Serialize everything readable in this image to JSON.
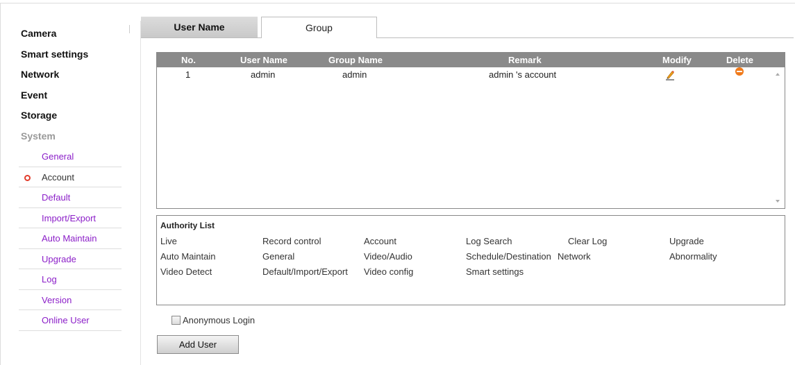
{
  "sidebar": {
    "top_items": [
      "Camera",
      "Smart settings",
      "Network",
      "Event",
      "Storage"
    ],
    "section": "System",
    "sub_items": [
      "General",
      "Account",
      "Default",
      "Import/Export",
      "Auto Maintain",
      "Upgrade",
      "Log",
      "Version",
      "Online User"
    ],
    "active_sub": "Account"
  },
  "tabs": {
    "user_name": "User Name",
    "group": "Group",
    "active": "User Name"
  },
  "user_table": {
    "headers": {
      "no": "No.",
      "user_name": "User Name",
      "group_name": "Group Name",
      "remark": "Remark",
      "modify": "Modify",
      "delete": "Delete"
    },
    "rows": [
      {
        "no": "1",
        "user_name": "admin",
        "group_name": "admin",
        "remark": "admin 's account",
        "modify_icon": "edit-pencil-icon",
        "delete_icon": "delete-circle-icon"
      }
    ]
  },
  "authority": {
    "title": "Authority List",
    "items": [
      "Live",
      "Record control",
      "Account",
      "Log Search",
      "Clear Log",
      "Upgrade",
      "Auto Maintain",
      "General",
      "Video/Audio",
      "Schedule/Destination",
      "Network",
      "Abnormality",
      "Video Detect",
      "Default/Import/Export",
      "Video config",
      "Smart settings"
    ]
  },
  "anonymous_login": {
    "label": "Anonymous Login",
    "checked": false
  },
  "add_user_label": "Add User",
  "colors": {
    "accent_link": "#8b1ec8",
    "header_bg": "#8a8a8a",
    "active_dot": "#e23b2a",
    "delete_icon": "#f07a1a"
  }
}
